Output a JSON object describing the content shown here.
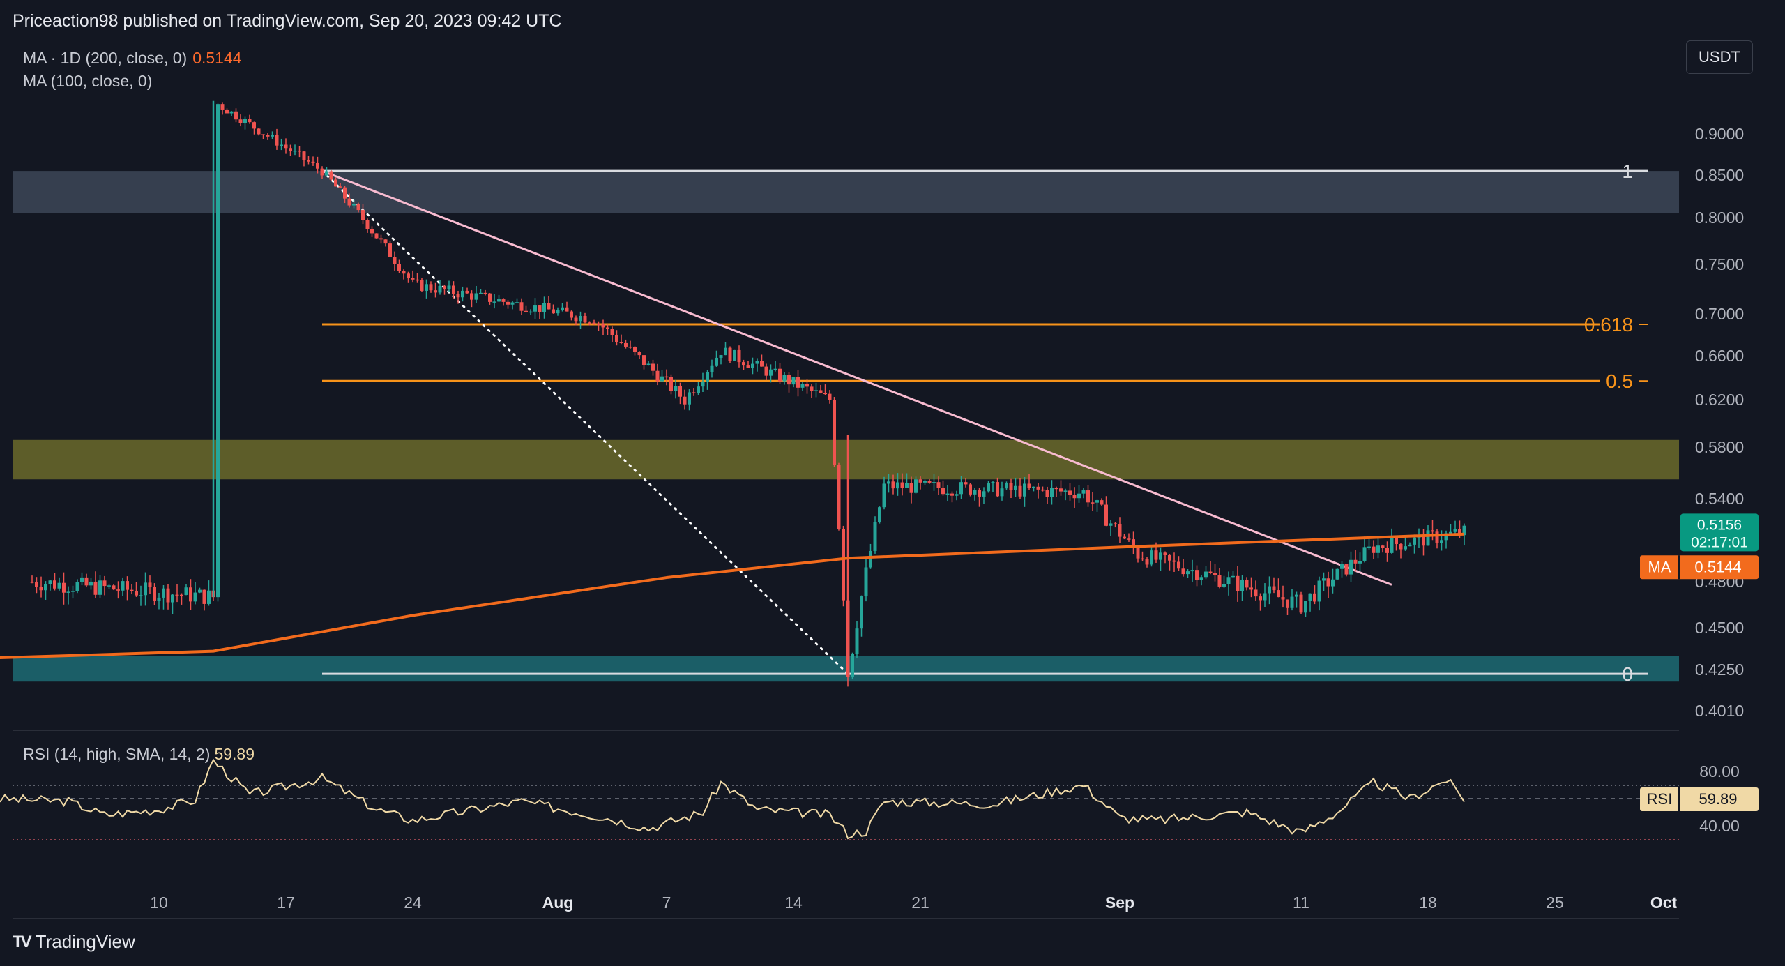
{
  "header": {
    "attribution": "Priceaction98 published on TradingView.com, Sep 20, 2023 09:42 UTC"
  },
  "indicators": {
    "ma200_label": "MA · 1D (200, close, 0)",
    "ma200_value": "0.5144",
    "ma100_label": "MA (100, close, 0)",
    "rsi_label": "RSI (14, high, SMA, 14, 2)",
    "rsi_value": "59.89"
  },
  "currency_button": "USDT",
  "footer": {
    "logo_text": "TradingView"
  },
  "colors": {
    "background": "#131722",
    "candle_up": "#26a69a",
    "candle_down": "#ef5350",
    "ma200": "#f26b1d",
    "fib_levels": "#f7931a",
    "downtrend_line": "#f8bbd0",
    "resistance_zone": "#4a5568",
    "supply_zone": "#6b6a2a",
    "support_zone": "#1d6b73",
    "rsi_line": "#f0d9a6",
    "price_tag": "#089981"
  },
  "chart_data": {
    "type": "candlestick",
    "title": "",
    "price_axis": {
      "ticks": [
        "0.9000",
        "0.8500",
        "0.8000",
        "0.7500",
        "0.7000",
        "0.6600",
        "0.6200",
        "0.5800",
        "0.5400",
        "0.4800",
        "0.4500",
        "0.4250",
        "0.4010"
      ]
    },
    "time_axis": {
      "ticks": [
        "10",
        "17",
        "24",
        "Aug",
        "7",
        "14",
        "21",
        "Sep",
        "11",
        "18",
        "25",
        "Oct"
      ],
      "bold_ticks": [
        "Aug",
        "Sep",
        "Oct"
      ]
    },
    "last_price": {
      "value": "0.5156",
      "countdown": "02:17:01"
    },
    "ma_tag": {
      "label": "MA",
      "value": "0.5144"
    },
    "fibonacci": [
      {
        "label": "1",
        "price": 0.855
      },
      {
        "label": "0.618",
        "price": 0.69
      },
      {
        "label": "0.5",
        "price": 0.637
      },
      {
        "label": "0",
        "price": 0.4225
      }
    ],
    "zones": [
      {
        "name": "resistance",
        "top": 0.855,
        "bottom": 0.805
      },
      {
        "name": "supply",
        "top": 0.586,
        "bottom": 0.555
      },
      {
        "name": "support",
        "top": 0.433,
        "bottom": 0.418
      }
    ],
    "key_points": [
      {
        "date": "Jul 3",
        "price": 0.48
      },
      {
        "date": "Jul 13",
        "price": 0.47
      },
      {
        "date": "Jul 13",
        "price": 0.94
      },
      {
        "date": "Jul 19",
        "price": 0.855
      },
      {
        "date": "Jul 24",
        "price": 0.73
      },
      {
        "date": "Aug 3",
        "price": 0.695
      },
      {
        "date": "Aug 8",
        "price": 0.62
      },
      {
        "date": "Aug 10",
        "price": 0.665
      },
      {
        "date": "Aug 16",
        "price": 0.62
      },
      {
        "date": "Aug 17",
        "price": 0.4225
      },
      {
        "date": "Aug 19",
        "price": 0.55
      },
      {
        "date": "Aug 30",
        "price": 0.545
      },
      {
        "date": "Sep 2",
        "price": 0.5
      },
      {
        "date": "Sep 11",
        "price": 0.465
      },
      {
        "date": "Sep 15",
        "price": 0.505
      },
      {
        "date": "Sep 20",
        "price": 0.5156
      }
    ],
    "ma200_points": [
      {
        "date": "Jul 1",
        "price": 0.432
      },
      {
        "date": "Jul 13",
        "price": 0.436
      },
      {
        "date": "Jul 24",
        "price": 0.458
      },
      {
        "date": "Aug 7",
        "price": 0.483
      },
      {
        "date": "Aug 17",
        "price": 0.497
      },
      {
        "date": "Sep 1",
        "price": 0.505
      },
      {
        "date": "Sep 20",
        "price": 0.5144
      }
    ],
    "downtrend_line": {
      "start": {
        "date": "Jul 19",
        "price": 0.855
      },
      "end": {
        "date": "Sep 16",
        "price": 0.478
      }
    },
    "fib_swing": {
      "start": {
        "date": "Jul 19",
        "price": 0.855
      },
      "end": {
        "date": "Aug 17",
        "price": 0.4225
      }
    },
    "rsi": {
      "ticks": [
        "80.00",
        "40.00"
      ],
      "upper_band": 80,
      "lower_band": 40,
      "current": 59.89,
      "points": [
        {
          "date": "Jul 1",
          "value": 60
        },
        {
          "date": "Jul 5",
          "value": 58
        },
        {
          "date": "Jul 7",
          "value": 48
        },
        {
          "date": "Jul 10",
          "value": 52
        },
        {
          "date": "Jul 12",
          "value": 59
        },
        {
          "date": "Jul 13",
          "value": 88
        },
        {
          "date": "Jul 15",
          "value": 63
        },
        {
          "date": "Jul 19",
          "value": 75
        },
        {
          "date": "Jul 22",
          "value": 52
        },
        {
          "date": "Jul 24",
          "value": 44
        },
        {
          "date": "Jul 30",
          "value": 58
        },
        {
          "date": "Aug 4",
          "value": 45
        },
        {
          "date": "Aug 6",
          "value": 38
        },
        {
          "date": "Aug 9",
          "value": 50
        },
        {
          "date": "Aug 10",
          "value": 72
        },
        {
          "date": "Aug 12",
          "value": 52
        },
        {
          "date": "Aug 16",
          "value": 48
        },
        {
          "date": "Aug 17",
          "value": 34
        },
        {
          "date": "Aug 18",
          "value": 36
        },
        {
          "date": "Aug 19",
          "value": 58
        },
        {
          "date": "Aug 25",
          "value": 56
        },
        {
          "date": "Aug 30",
          "value": 70
        },
        {
          "date": "Sep 1",
          "value": 46
        },
        {
          "date": "Sep 3",
          "value": 44
        },
        {
          "date": "Sep 8",
          "value": 50
        },
        {
          "date": "Sep 11",
          "value": 35
        },
        {
          "date": "Sep 13",
          "value": 50
        },
        {
          "date": "Sep 15",
          "value": 72
        },
        {
          "date": "Sep 17",
          "value": 60
        },
        {
          "date": "Sep 19",
          "value": 74
        },
        {
          "date": "Sep 20",
          "value": 59.89
        }
      ]
    }
  }
}
